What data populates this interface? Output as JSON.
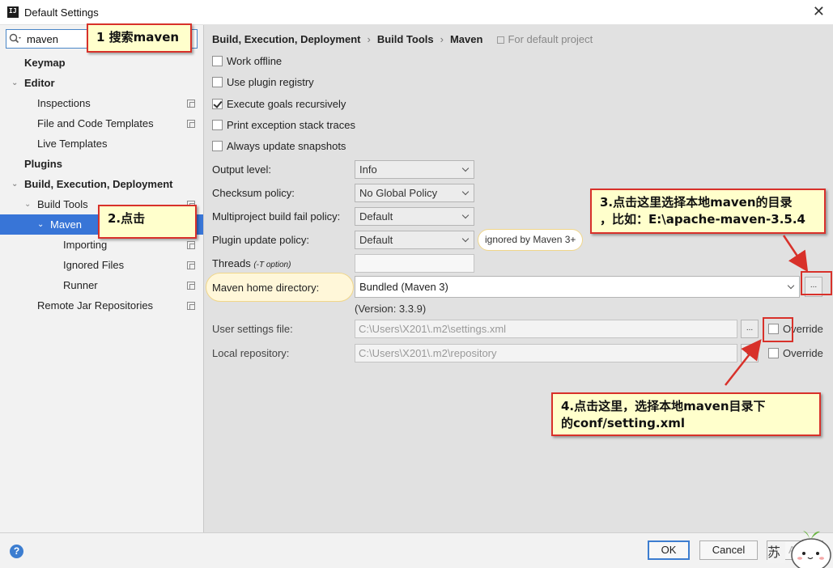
{
  "window": {
    "title": "Default Settings"
  },
  "search": {
    "value": "maven"
  },
  "sidebar": {
    "items": [
      {
        "label": "Keymap"
      },
      {
        "label": "Editor"
      },
      {
        "label": "Inspections"
      },
      {
        "label": "File and Code Templates"
      },
      {
        "label": "Live Templates"
      },
      {
        "label": "Plugins"
      },
      {
        "label": "Build, Execution, Deployment"
      },
      {
        "label": "Build Tools"
      },
      {
        "label": "Maven"
      },
      {
        "label": "Importing"
      },
      {
        "label": "Ignored Files"
      },
      {
        "label": "Runner"
      },
      {
        "label": "Remote Jar Repositories"
      }
    ]
  },
  "breadcrumb": {
    "part1": "Build, Execution, Deployment",
    "part2": "Build Tools",
    "part3": "Maven",
    "separator": "›",
    "hint": "For default project"
  },
  "options": {
    "work_offline": {
      "label": "Work offline",
      "checked": false
    },
    "use_plugin_registry": {
      "label": "Use plugin registry",
      "checked": false
    },
    "execute_goals_recursively": {
      "label": "Execute goals recursively",
      "checked": true
    },
    "print_exception": {
      "label": "Print exception stack traces",
      "checked": false
    },
    "always_update": {
      "label": "Always update snapshots",
      "checked": false
    }
  },
  "form": {
    "output_level": {
      "label": "Output level:",
      "value": "Info"
    },
    "checksum_policy": {
      "label": "Checksum policy:",
      "value": "No Global Policy"
    },
    "multiproject_fail": {
      "label": "Multiproject build fail policy:",
      "value": "Default"
    },
    "plugin_update": {
      "label": "Plugin update policy:",
      "value": "Default",
      "note": "ignored by Maven 3+"
    },
    "threads": {
      "label": "Threads",
      "note": "(-T option)"
    },
    "maven_home": {
      "label": "Maven home directory:",
      "value": "Bundled (Maven 3)",
      "version": "(Version: 3.3.9)"
    },
    "user_settings": {
      "label": "User settings file:",
      "value": "C:\\Users\\X201\\.m2\\settings.xml",
      "override": "Override"
    },
    "local_repo": {
      "label": "Local repository:",
      "value": "C:\\Users\\X201\\.m2\\repository",
      "override": "Override"
    },
    "browse_label": "..."
  },
  "footer": {
    "help": "?",
    "ok": "OK",
    "cancel": "Cancel",
    "apply": "Ap"
  },
  "annotations": {
    "step1": "1 搜索maven",
    "step2": "2.点击",
    "step3_line1": "3.点击这里选择本地maven的目录",
    "step3_line2": "，比如：E:\\apache-maven-3.5.4",
    "step4_line1": "4.点击这里，选择本地maven目录下",
    "step4_line2": "的conf/setting.xml"
  },
  "watermark": {
    "char": "苏"
  },
  "colors": {
    "selection": "#3875d7",
    "callout_border": "#d8312a",
    "callout_bg": "#ffffcc"
  }
}
